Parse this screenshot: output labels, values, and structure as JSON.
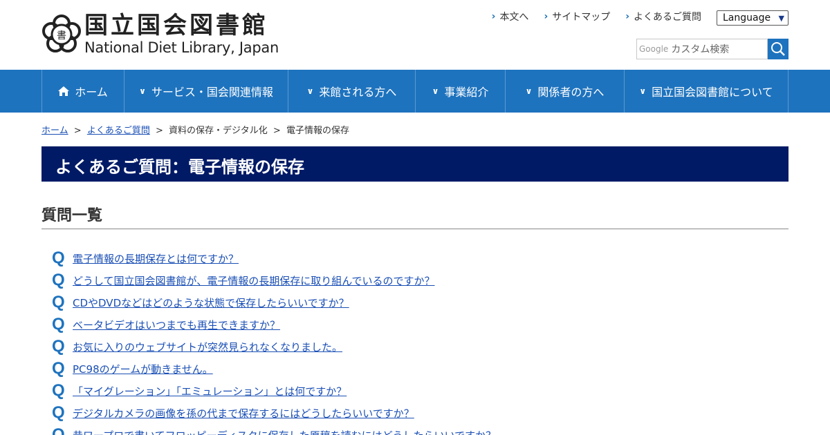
{
  "header": {
    "logo_jp": "国立国会図書館",
    "logo_en": "National Diet Library, Japan",
    "util_links": [
      "本文へ",
      "サイトマップ",
      "よくあるご質問"
    ],
    "language_select": "Language",
    "search": {
      "google_label": "Google",
      "placeholder": "カスタム検索"
    }
  },
  "nav": {
    "items": [
      {
        "label": "ホーム",
        "icon": "home-icon"
      },
      {
        "label": "サービス・国会関連情報",
        "icon": "chevron-down-icon"
      },
      {
        "label": "来館される方へ",
        "icon": "chevron-down-icon"
      },
      {
        "label": "事業紹介",
        "icon": "chevron-down-icon"
      },
      {
        "label": "関係者の方へ",
        "icon": "chevron-down-icon"
      },
      {
        "label": "国立国会図書館について",
        "icon": "chevron-down-icon"
      }
    ]
  },
  "breadcrumb": {
    "home": "ホーム",
    "faq": "よくあるご質問",
    "category": "資料の保存・デジタル化",
    "current": "電子情報の保存",
    "separator": ">"
  },
  "page_title": "よくあるご質問：電子情報の保存",
  "section_heading": "質問一覧",
  "questions": {
    "marker": "Q",
    "items": [
      "電子情報の長期保存とは何ですか？",
      "どうして国立国会図書館が、電子情報の長期保存に取り組んでいるのですか？",
      "CDやDVDなどはどのような状態で保存したらいいですか？",
      "ベータビデオはいつまでも再生できますか？",
      "お気に入りのウェブサイトが突然見られなくなりました。",
      "PC98のゲームが動きません。",
      "「マイグレーション」「エミュレーション」とは何ですか？",
      "デジタルカメラの画像を孫の代まで保存するにはどうしたらいいですか？",
      "昔ワープロで書いてフロッピーディスクに保存した原稿を読むにはどうしたらいいですか？"
    ]
  },
  "colors": {
    "nav_blue": "#1e73be",
    "banner_navy": "#001a66",
    "link_blue": "#1a4fb5"
  }
}
